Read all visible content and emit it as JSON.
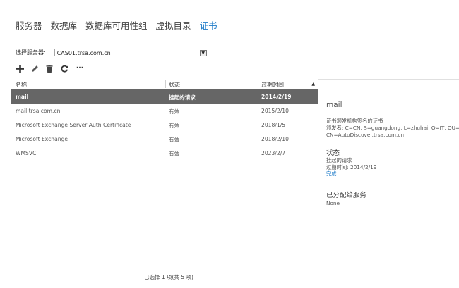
{
  "tabs": [
    {
      "label": "服务器",
      "active": false
    },
    {
      "label": "数据库",
      "active": false
    },
    {
      "label": "数据库可用性组",
      "active": false
    },
    {
      "label": "虚拟目录",
      "active": false
    },
    {
      "label": "证书",
      "active": true
    }
  ],
  "server_selector": {
    "label": "选择服务器:",
    "value": "CAS01.trsa.com.cn"
  },
  "toolbar": {
    "icons": [
      "plus-icon",
      "pencil-icon",
      "trash-icon",
      "refresh-icon",
      "more-icon"
    ],
    "more_label": "···"
  },
  "grid": {
    "columns": [
      "名称",
      "状态",
      "过期时间"
    ],
    "rows": [
      {
        "name": "mail",
        "status": "挂起的请求",
        "expires": "2014/2/19",
        "selected": true
      },
      {
        "name": "mail.trsa.com.cn",
        "status": "有效",
        "expires": "2015/2/10",
        "selected": false
      },
      {
        "name": "Microsoft Exchange Server Auth Certificate",
        "status": "有效",
        "expires": "2018/1/5",
        "selected": false
      },
      {
        "name": "Microsoft Exchange",
        "status": "有效",
        "expires": "2018/2/10",
        "selected": false
      },
      {
        "name": "WMSVC",
        "status": "有效",
        "expires": "2023/2/7",
        "selected": false
      }
    ]
  },
  "details": {
    "title": "mail",
    "issuer_label": "证书颁发机构签名的证书",
    "issuer_line1": "颁发者: C=CN, S=guangdong, L=zhuhai, O=IT, OU=trsa,",
    "issuer_line2": "CN=AutoDiscover.trsa.com.cn",
    "status_heading": "状态",
    "status_value": "挂起的请求",
    "expiry_line": "过期时间: 2014/2/19",
    "complete_link": "完成",
    "services_heading": "已分配给服务",
    "services_value": "None"
  },
  "status_bar": "已选择 1 项(共 5 项)",
  "colors": {
    "accent": "#1e7bc8",
    "selected_row": "#666666"
  }
}
